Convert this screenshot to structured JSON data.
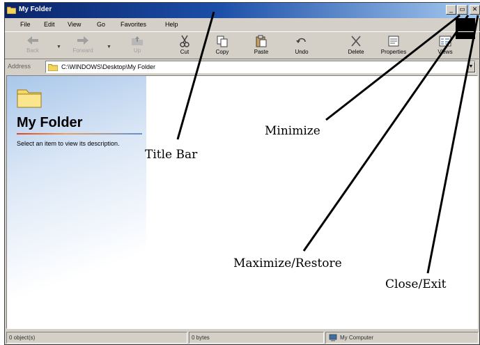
{
  "window": {
    "title": "My Folder",
    "buttons": {
      "minimize_glyph": "_",
      "maximize_glyph": "▭",
      "close_glyph": "✕"
    }
  },
  "menu": [
    "File",
    "Edit",
    "View",
    "Go",
    "Favorites",
    "Help"
  ],
  "toolbar": {
    "buttons": [
      {
        "label": "Back",
        "icon": "back-arrow-icon",
        "enabled": false
      },
      {
        "label": "Forward",
        "icon": "forward-arrow-icon",
        "enabled": false
      },
      {
        "label": "Up",
        "icon": "up-folder-icon",
        "enabled": false
      },
      {
        "label": "Cut",
        "icon": "scissors-icon",
        "enabled": true
      },
      {
        "label": "Copy",
        "icon": "copy-icon",
        "enabled": true
      },
      {
        "label": "Paste",
        "icon": "paste-icon",
        "enabled": true
      },
      {
        "label": "Undo",
        "icon": "undo-icon",
        "enabled": true
      },
      {
        "label": "Delete",
        "icon": "delete-x-icon",
        "enabled": true
      },
      {
        "label": "Properties",
        "icon": "properties-icon",
        "enabled": true
      },
      {
        "label": "Views",
        "icon": "views-icon",
        "enabled": true
      }
    ]
  },
  "address": {
    "label": "Address",
    "value": "C:\\WINDOWS\\Desktop\\My Folder"
  },
  "content": {
    "folder_title": "My Folder",
    "description": "Select an item to view its description."
  },
  "status": {
    "objects": "0 object(s)",
    "size": "0 bytes",
    "zone": "My Computer"
  },
  "annotations": {
    "title_bar": "Title Bar",
    "minimize": "Minimize",
    "maximize_restore": "Maximize/Restore",
    "close_exit": "Close/Exit"
  },
  "colors": {
    "title_start": "#0a246a",
    "title_end": "#a6caf0",
    "chrome": "#d4d0c8",
    "annotation_line": "#000000"
  }
}
